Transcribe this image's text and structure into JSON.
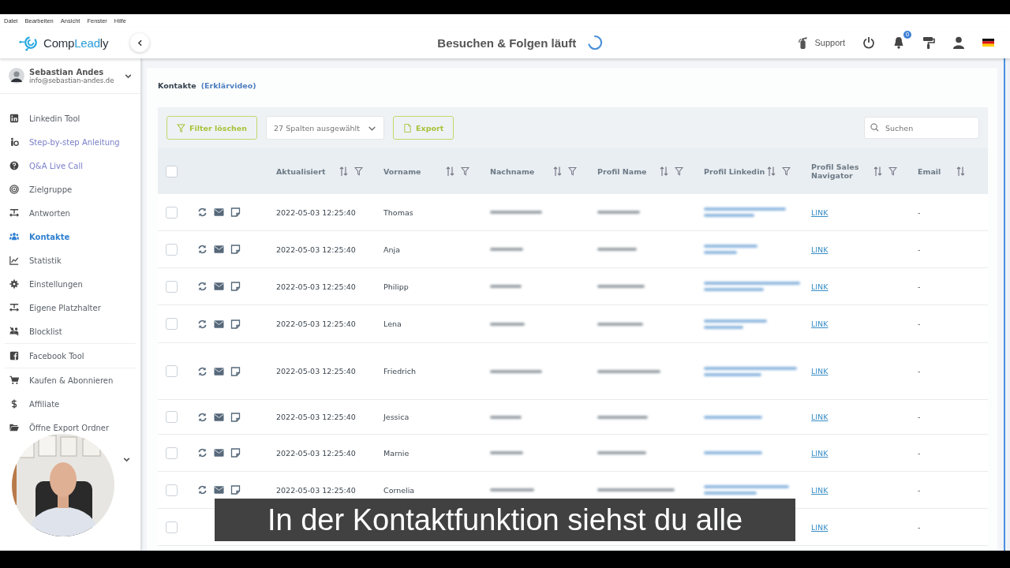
{
  "menu_bar": [
    "Datei",
    "Bearbeiten",
    "Ansicht",
    "Fenster",
    "Hilfe"
  ],
  "logo": [
    {
      "text": "Comp",
      "accent": false
    },
    {
      "text": "Lead",
      "accent": true
    },
    {
      "text": "ly",
      "accent": false
    }
  ],
  "header": {
    "title": "Besuchen & Folgen läuft",
    "loading": true,
    "support": "Support",
    "notifications": "0"
  },
  "user": {
    "name": "Sebastian Andes",
    "email": "info@sebastian-andes.de"
  },
  "sidebar": {
    "items": [
      {
        "label": "Linkedin Tool",
        "selected": false,
        "color": "#5a6068",
        "divider": false
      },
      {
        "label": "Step-by-step Anleitung",
        "selected": false,
        "color": "#7b80c8",
        "divider": false
      },
      {
        "label": "Q&A Live Call",
        "selected": false,
        "color": "#7b80c8",
        "divider": false
      },
      {
        "label": "Zielgruppe",
        "selected": false,
        "color": "#5a6068",
        "divider": false
      },
      {
        "label": "Antworten",
        "selected": false,
        "color": "#5a6068",
        "divider": false
      },
      {
        "label": "Kontakte",
        "selected": true,
        "color": "#2f80d0",
        "divider": false
      },
      {
        "label": "Statistik",
        "selected": false,
        "color": "#5a6068",
        "divider": false
      },
      {
        "label": "Einstellungen",
        "selected": false,
        "color": "#5a6068",
        "divider": false
      },
      {
        "label": "Eigene Platzhalter",
        "selected": false,
        "color": "#5a6068",
        "divider": false
      },
      {
        "label": "Blocklist",
        "selected": false,
        "color": "#5a6068",
        "divider": true
      },
      {
        "label": "Facebook Tool",
        "selected": false,
        "color": "#5a6068",
        "divider": true
      },
      {
        "label": "Kaufen & Abonnieren",
        "selected": false,
        "color": "#5a6068",
        "divider": false
      },
      {
        "label": "Affiliate",
        "selected": false,
        "color": "#5a6068",
        "divider": false
      },
      {
        "label": "Öffne Export Ordner",
        "selected": false,
        "color": "#5a6068",
        "divider": false
      }
    ]
  },
  "page": {
    "title": "Kontakte",
    "help_link": "(Erklärvideo)"
  },
  "toolbar": {
    "clear_filter": "Filter löschen",
    "columns_select": "27 Spalten ausgewählt",
    "export": "Export",
    "search": {
      "placeholder": "Suchen"
    }
  },
  "table": {
    "select_all": {
      "checked": false
    },
    "columns": [
      {
        "label": "Aktualisiert",
        "filterable": true
      },
      {
        "label": "Vorname",
        "filterable": true
      },
      {
        "label": "Nachname",
        "filterable": true
      },
      {
        "label": "Profil Name",
        "filterable": true
      },
      {
        "label": "Profil Linkedin",
        "filterable": true
      },
      {
        "label": "Profil Sales Navigator",
        "filterable": true
      },
      {
        "label": "Email",
        "filterable": false
      }
    ],
    "rows": [
      {
        "checked": false,
        "actions": true,
        "updated": "2022-05-03 12:25:40",
        "first_name": "Thomas",
        "sales_navigator": "LINK",
        "email": "-"
      },
      {
        "checked": false,
        "actions": true,
        "updated": "2022-05-03 12:25:40",
        "first_name": "Anja",
        "sales_navigator": "LINK",
        "email": "-"
      },
      {
        "checked": false,
        "actions": true,
        "updated": "2022-05-03 12:25:40",
        "first_name": "Philipp",
        "sales_navigator": "LINK",
        "email": "-"
      },
      {
        "checked": false,
        "actions": true,
        "updated": "2022-05-03 12:25:40",
        "first_name": "Lena",
        "sales_navigator": "LINK",
        "email": "-"
      },
      {
        "checked": false,
        "actions": true,
        "updated": "2022-05-03 12:25:40",
        "first_name": "Friedrich",
        "sales_navigator": "LINK",
        "email": "-"
      },
      {
        "checked": false,
        "actions": true,
        "updated": "2022-05-03 12:25:40",
        "first_name": "Jessica",
        "sales_navigator": "LINK",
        "email": "-"
      },
      {
        "checked": false,
        "actions": true,
        "updated": "2022-05-03 12:25:40",
        "first_name": "Marnie",
        "sales_navigator": "LINK",
        "email": "-"
      },
      {
        "checked": false,
        "actions": true,
        "updated": "2022-05-03 12:25:40",
        "first_name": "Cornelia",
        "sales_navigator": "LINK",
        "email": "-"
      },
      {
        "checked": false,
        "actions": false,
        "sales_navigator": "LINK",
        "email": "-"
      }
    ]
  },
  "subtitle": "In der Kontaktfunktion siehst du alle"
}
